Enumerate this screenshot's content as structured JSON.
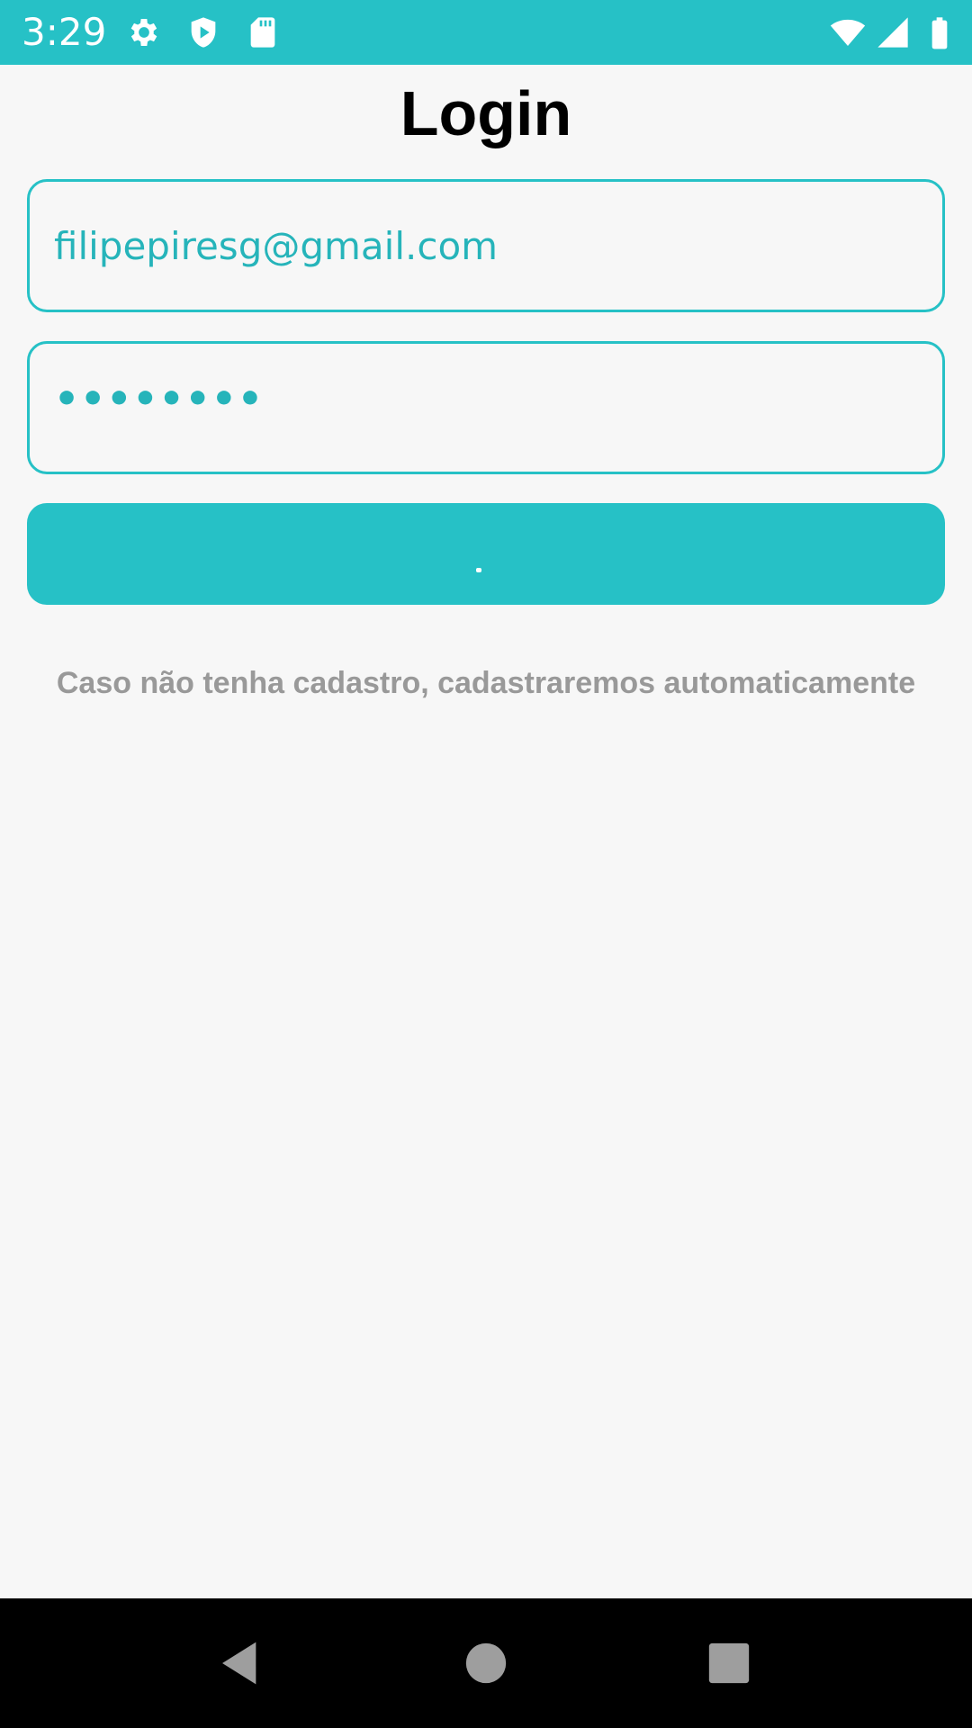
{
  "status_bar": {
    "time": "3:29",
    "icons_left": [
      "gear-icon",
      "shield-play-icon",
      "sd-card-icon"
    ],
    "icons_right": [
      "wifi-icon",
      "cell-signal-icon",
      "battery-icon"
    ],
    "background": "#26c1c6"
  },
  "page": {
    "title": "Login"
  },
  "form": {
    "email_value": "filipepiresg@gmail.com",
    "password_value": "••••••••",
    "submit_label": ".",
    "hint": "Caso não tenha cadastro, cadastraremos automaticamente"
  },
  "colors": {
    "accent": "#26c1c6",
    "background": "#f7f7f7",
    "hint_text": "#999999"
  },
  "nav_bar": {
    "buttons": [
      "back-icon",
      "home-icon",
      "recents-icon"
    ]
  }
}
